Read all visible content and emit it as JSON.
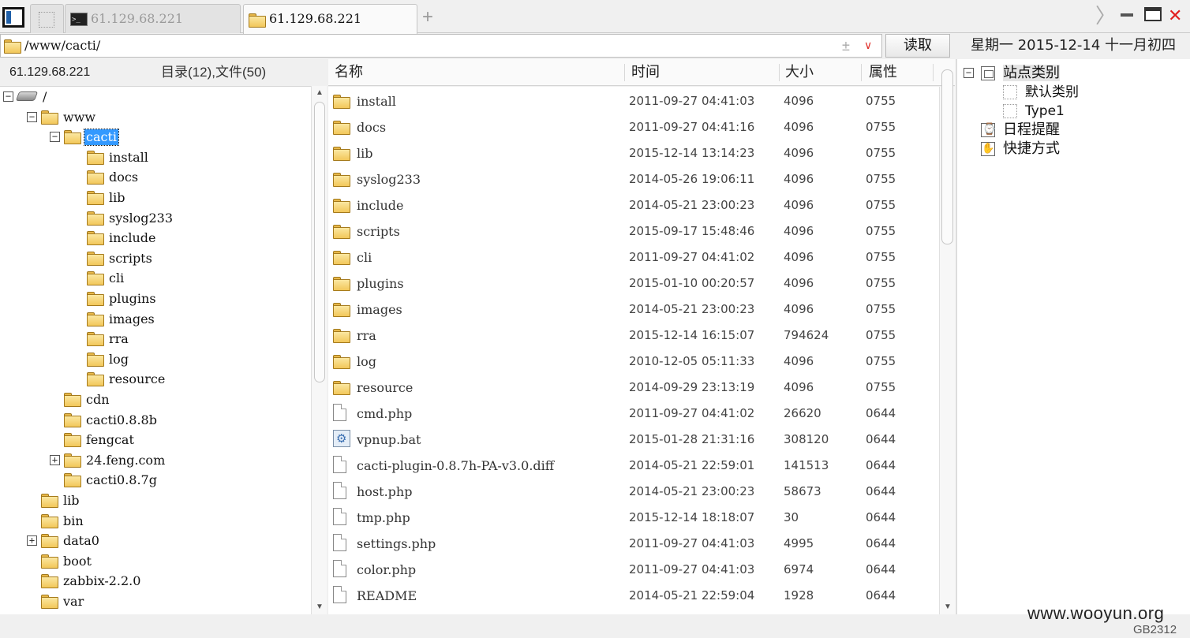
{
  "tabs": [
    {
      "label": ""
    },
    {
      "label": "61.129.68.221"
    },
    {
      "label": "61.129.68.221"
    }
  ],
  "tab_add_label": "+",
  "window": {
    "close": "✕",
    "next": "〉"
  },
  "address": {
    "path": "/www/cacti/",
    "pm": "±",
    "drop": "∨",
    "read_button": "读取"
  },
  "date_bar": "星期一 2015-12-14 十一月初四",
  "tree_header": {
    "host": "61.129.68.221",
    "count": "目录(12),文件(50)"
  },
  "tree": [
    {
      "label": "/",
      "type": "drive",
      "level": 0,
      "expander": "−"
    },
    {
      "label": "www",
      "type": "folder",
      "level": 1,
      "expander": "−"
    },
    {
      "label": "cacti",
      "type": "folder",
      "level": 2,
      "expander": "−",
      "selected": true
    },
    {
      "label": "install",
      "type": "folder",
      "level": 3
    },
    {
      "label": "docs",
      "type": "folder",
      "level": 3
    },
    {
      "label": "lib",
      "type": "folder",
      "level": 3
    },
    {
      "label": "syslog233",
      "type": "folder",
      "level": 3
    },
    {
      "label": "include",
      "type": "folder",
      "level": 3
    },
    {
      "label": "scripts",
      "type": "folder",
      "level": 3
    },
    {
      "label": "cli",
      "type": "folder",
      "level": 3
    },
    {
      "label": "plugins",
      "type": "folder",
      "level": 3
    },
    {
      "label": "images",
      "type": "folder",
      "level": 3
    },
    {
      "label": "rra",
      "type": "folder",
      "level": 3
    },
    {
      "label": "log",
      "type": "folder",
      "level": 3
    },
    {
      "label": "resource",
      "type": "folder",
      "level": 3
    },
    {
      "label": "cdn",
      "type": "folder",
      "level": 2
    },
    {
      "label": "cacti0.8.8b",
      "type": "folder",
      "level": 2
    },
    {
      "label": "fengcat",
      "type": "folder",
      "level": 2
    },
    {
      "label": "24.feng.com",
      "type": "folder",
      "level": 2,
      "expander": "+"
    },
    {
      "label": "cacti0.8.7g",
      "type": "folder",
      "level": 2
    },
    {
      "label": "lib",
      "type": "folder",
      "level": 1
    },
    {
      "label": "bin",
      "type": "folder",
      "level": 1
    },
    {
      "label": "data0",
      "type": "folder",
      "level": 1,
      "expander": "+"
    },
    {
      "label": "boot",
      "type": "folder",
      "level": 1
    },
    {
      "label": "zabbix-2.2.0",
      "type": "folder",
      "level": 1
    },
    {
      "label": "var",
      "type": "folder",
      "level": 1
    }
  ],
  "list_columns": {
    "name": "名称",
    "time": "时间",
    "size": "大小",
    "attr": "属性"
  },
  "files": [
    {
      "name": "install",
      "type": "folder",
      "time": "2011-09-27 04:41:03",
      "size": "4096",
      "attr": "0755"
    },
    {
      "name": "docs",
      "type": "folder",
      "time": "2011-09-27 04:41:16",
      "size": "4096",
      "attr": "0755"
    },
    {
      "name": "lib",
      "type": "folder",
      "time": "2015-12-14 13:14:23",
      "size": "4096",
      "attr": "0755"
    },
    {
      "name": "syslog233",
      "type": "folder",
      "time": "2014-05-26 19:06:11",
      "size": "4096",
      "attr": "0755"
    },
    {
      "name": "include",
      "type": "folder",
      "time": "2014-05-21 23:00:23",
      "size": "4096",
      "attr": "0755"
    },
    {
      "name": "scripts",
      "type": "folder",
      "time": "2015-09-17 15:48:46",
      "size": "4096",
      "attr": "0755"
    },
    {
      "name": "cli",
      "type": "folder",
      "time": "2011-09-27 04:41:02",
      "size": "4096",
      "attr": "0755"
    },
    {
      "name": "plugins",
      "type": "folder",
      "time": "2015-01-10 00:20:57",
      "size": "4096",
      "attr": "0755"
    },
    {
      "name": "images",
      "type": "folder",
      "time": "2014-05-21 23:00:23",
      "size": "4096",
      "attr": "0755"
    },
    {
      "name": "rra",
      "type": "folder",
      "time": "2015-12-14 16:15:07",
      "size": "794624",
      "attr": "0755"
    },
    {
      "name": "log",
      "type": "folder",
      "time": "2010-12-05 05:11:33",
      "size": "4096",
      "attr": "0755"
    },
    {
      "name": "resource",
      "type": "folder",
      "time": "2014-09-29 23:13:19",
      "size": "4096",
      "attr": "0755"
    },
    {
      "name": "cmd.php",
      "type": "file",
      "time": "2011-09-27 04:41:02",
      "size": "26620",
      "attr": "0644"
    },
    {
      "name": "vpnup.bat",
      "type": "bat",
      "time": "2015-01-28 21:31:16",
      "size": "308120",
      "attr": "0644"
    },
    {
      "name": "cacti-plugin-0.8.7h-PA-v3.0.diff",
      "type": "file",
      "time": "2014-05-21 22:59:01",
      "size": "141513",
      "attr": "0644"
    },
    {
      "name": "host.php",
      "type": "file",
      "time": "2014-05-21 23:00:23",
      "size": "58673",
      "attr": "0644"
    },
    {
      "name": "tmp.php",
      "type": "file",
      "time": "2015-12-14 18:18:07",
      "size": "30",
      "attr": "0644"
    },
    {
      "name": "settings.php",
      "type": "file",
      "time": "2011-09-27 04:41:03",
      "size": "4995",
      "attr": "0644"
    },
    {
      "name": "color.php",
      "type": "file",
      "time": "2011-09-27 04:41:03",
      "size": "6974",
      "attr": "0644"
    },
    {
      "name": "README",
      "type": "file",
      "time": "2014-05-21 22:59:04",
      "size": "1928",
      "attr": "0644"
    }
  ],
  "right_tree": [
    {
      "label": "站点类别",
      "icon": "category-icon",
      "expander": "−",
      "indent": 0,
      "highlight": true
    },
    {
      "label": "默认类别",
      "icon": "dotted",
      "indent": 1
    },
    {
      "label": "Type1",
      "icon": "dotted",
      "indent": 1
    },
    {
      "label": "日程提醒",
      "icon": "clock-icon",
      "indent": 0
    },
    {
      "label": "快捷方式",
      "icon": "hand-icon",
      "indent": 0
    }
  ],
  "footer": {
    "watermark": "www.wooyun.org",
    "encoding": "GB2312"
  },
  "colors": {
    "selection": "#3399ff",
    "close": "#e21b1b",
    "folder": "#f2c75a"
  }
}
